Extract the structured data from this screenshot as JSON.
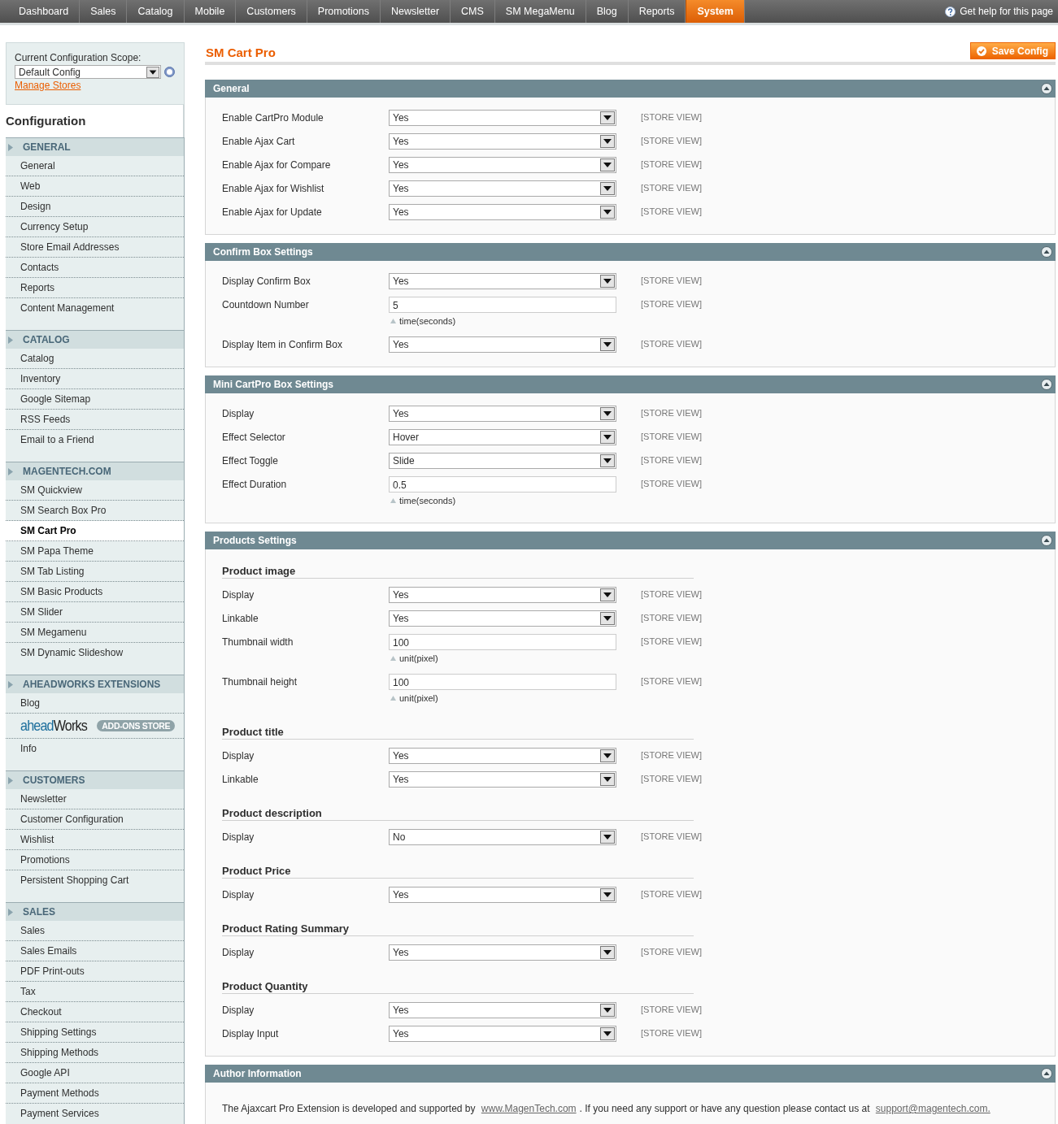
{
  "nav": {
    "tabs": [
      {
        "label": "Dashboard",
        "selected": false
      },
      {
        "label": "Sales",
        "selected": false
      },
      {
        "label": "Catalog",
        "selected": false
      },
      {
        "label": "Mobile",
        "selected": false
      },
      {
        "label": "Customers",
        "selected": false
      },
      {
        "label": "Promotions",
        "selected": false
      },
      {
        "label": "Newsletter",
        "selected": false
      },
      {
        "label": "CMS",
        "selected": false
      },
      {
        "label": "SM MegaMenu",
        "selected": false
      },
      {
        "label": "Blog",
        "selected": false
      },
      {
        "label": "Reports",
        "selected": false
      },
      {
        "label": "System",
        "selected": true
      }
    ],
    "help": "Get help for this page"
  },
  "scope": {
    "label": "Current Configuration Scope:",
    "value": "Default Config",
    "link": "Manage Stores"
  },
  "sidebar": {
    "title": "Configuration",
    "groups": [
      {
        "title": "GENERAL",
        "items": [
          {
            "label": "General",
            "selected": false
          },
          {
            "label": "Web",
            "selected": false
          },
          {
            "label": "Design",
            "selected": false
          },
          {
            "label": "Currency Setup",
            "selected": false
          },
          {
            "label": "Store Email Addresses",
            "selected": false
          },
          {
            "label": "Contacts",
            "selected": false
          },
          {
            "label": "Reports",
            "selected": false
          },
          {
            "label": "Content Management",
            "selected": false
          }
        ]
      },
      {
        "title": "CATALOG",
        "items": [
          {
            "label": "Catalog",
            "selected": false
          },
          {
            "label": "Inventory",
            "selected": false
          },
          {
            "label": "Google Sitemap",
            "selected": false
          },
          {
            "label": "RSS Feeds",
            "selected": false
          },
          {
            "label": "Email to a Friend",
            "selected": false
          }
        ]
      },
      {
        "title": "MAGENTECH.COM",
        "items": [
          {
            "label": "SM Quickview",
            "selected": false
          },
          {
            "label": "SM Search Box Pro",
            "selected": false
          },
          {
            "label": "SM Cart Pro",
            "selected": true
          },
          {
            "label": "SM Papa Theme",
            "selected": false
          },
          {
            "label": "SM Tab Listing",
            "selected": false
          },
          {
            "label": "SM Basic Products",
            "selected": false
          },
          {
            "label": "SM Slider",
            "selected": false
          },
          {
            "label": "SM Megamenu",
            "selected": false
          },
          {
            "label": "SM Dynamic Slideshow",
            "selected": false
          }
        ]
      },
      {
        "title": "AHEADWORKS EXTENSIONS",
        "items": [
          {
            "kind": "link",
            "label": "Blog",
            "selected": false
          },
          {
            "kind": "logo",
            "logo_parts": [
              "ahead",
              "Works"
            ],
            "badge": "ADD-ONS STORE",
            "selected": false
          },
          {
            "kind": "link",
            "label": "Info",
            "selected": false
          }
        ]
      },
      {
        "title": "CUSTOMERS",
        "items": [
          {
            "label": "Newsletter",
            "selected": false
          },
          {
            "label": "Customer Configuration",
            "selected": false
          },
          {
            "label": "Wishlist",
            "selected": false
          },
          {
            "label": "Promotions",
            "selected": false
          },
          {
            "label": "Persistent Shopping Cart",
            "selected": false
          }
        ]
      },
      {
        "title": "SALES",
        "items": [
          {
            "label": "Sales",
            "selected": false
          },
          {
            "label": "Sales Emails",
            "selected": false
          },
          {
            "label": "PDF Print-outs",
            "selected": false
          },
          {
            "label": "Tax",
            "selected": false
          },
          {
            "label": "Checkout",
            "selected": false
          },
          {
            "label": "Shipping Settings",
            "selected": false
          },
          {
            "label": "Shipping Methods",
            "selected": false
          },
          {
            "label": "Google API",
            "selected": false
          },
          {
            "label": "Payment Methods",
            "selected": false
          },
          {
            "label": "Payment Services",
            "selected": false
          }
        ]
      }
    ]
  },
  "page": {
    "title": "SM Cart Pro",
    "save_button": "Save Config"
  },
  "sections": [
    {
      "title": "General",
      "expanded": true,
      "rows": [
        {
          "kind": "select",
          "label": "Enable CartPro Module",
          "value": "Yes",
          "scope": "[STORE VIEW]"
        },
        {
          "kind": "select",
          "label": "Enable Ajax Cart",
          "value": "Yes",
          "scope": "[STORE VIEW]"
        },
        {
          "kind": "select",
          "label": "Enable Ajax for Compare",
          "value": "Yes",
          "scope": "[STORE VIEW]"
        },
        {
          "kind": "select",
          "label": "Enable Ajax for Wishlist",
          "value": "Yes",
          "scope": "[STORE VIEW]"
        },
        {
          "kind": "select",
          "label": "Enable Ajax for Update",
          "value": "Yes",
          "scope": "[STORE VIEW]"
        }
      ]
    },
    {
      "title": "Confirm Box Settings",
      "expanded": true,
      "rows": [
        {
          "kind": "select",
          "label": "Display Confirm Box",
          "value": "Yes",
          "scope": "[STORE VIEW]"
        },
        {
          "kind": "text",
          "label": "Countdown Number",
          "value": "5",
          "scope": "[STORE VIEW]",
          "note": "time(seconds)"
        },
        {
          "kind": "select",
          "label": "Display Item in Confirm Box",
          "value": "Yes",
          "scope": "[STORE VIEW]"
        }
      ]
    },
    {
      "title": "Mini CartPro Box Settings",
      "expanded": true,
      "rows": [
        {
          "kind": "select",
          "label": "Display",
          "value": "Yes",
          "scope": "[STORE VIEW]"
        },
        {
          "kind": "select",
          "label": "Effect Selector",
          "value": "Hover",
          "scope": "[STORE VIEW]"
        },
        {
          "kind": "select",
          "label": "Effect Toggle",
          "value": "Slide",
          "scope": "[STORE VIEW]"
        },
        {
          "kind": "text",
          "label": "Effect Duration",
          "value": "0.5",
          "scope": "[STORE VIEW]",
          "note": "time(seconds)"
        }
      ]
    },
    {
      "title": "Products Settings",
      "expanded": true,
      "rows": [
        {
          "kind": "heading",
          "label": "Product image"
        },
        {
          "kind": "select",
          "label": "Display",
          "value": "Yes",
          "scope": "[STORE VIEW]"
        },
        {
          "kind": "select",
          "label": "Linkable",
          "value": "Yes",
          "scope": "[STORE VIEW]"
        },
        {
          "kind": "text",
          "label": "Thumbnail width",
          "value": "100",
          "scope": "[STORE VIEW]",
          "note": "unit(pixel)"
        },
        {
          "kind": "text",
          "label": "Thumbnail height",
          "value": "100",
          "scope": "[STORE VIEW]",
          "note": "unit(pixel)"
        },
        {
          "kind": "heading",
          "label": "Product title"
        },
        {
          "kind": "select",
          "label": "Display",
          "value": "Yes",
          "scope": "[STORE VIEW]"
        },
        {
          "kind": "select",
          "label": "Linkable",
          "value": "Yes",
          "scope": "[STORE VIEW]"
        },
        {
          "kind": "heading",
          "label": "Product description"
        },
        {
          "kind": "select",
          "label": "Display",
          "value": "No",
          "scope": "[STORE VIEW]"
        },
        {
          "kind": "heading",
          "label": "Product Price"
        },
        {
          "kind": "select",
          "label": "Display",
          "value": "Yes",
          "scope": "[STORE VIEW]"
        },
        {
          "kind": "heading",
          "label": "Product Rating Summary"
        },
        {
          "kind": "select",
          "label": "Display",
          "value": "Yes",
          "scope": "[STORE VIEW]"
        },
        {
          "kind": "heading",
          "label": "Product Quantity"
        },
        {
          "kind": "select",
          "label": "Display",
          "value": "Yes",
          "scope": "[STORE VIEW]"
        },
        {
          "kind": "select",
          "label": "Display Input",
          "value": "Yes",
          "scope": "[STORE VIEW]"
        }
      ]
    },
    {
      "title": "Author Information",
      "expanded": true,
      "paragraph": [
        {
          "kind": "text",
          "text": "The Ajaxcart Pro Extension is developed and supported by "
        },
        {
          "kind": "link",
          "text": "www.MagenTech.com"
        },
        {
          "kind": "text",
          "text": ". If you need any support or have any question please contact us at "
        },
        {
          "kind": "link",
          "text": "support@magentech.com."
        }
      ]
    }
  ]
}
